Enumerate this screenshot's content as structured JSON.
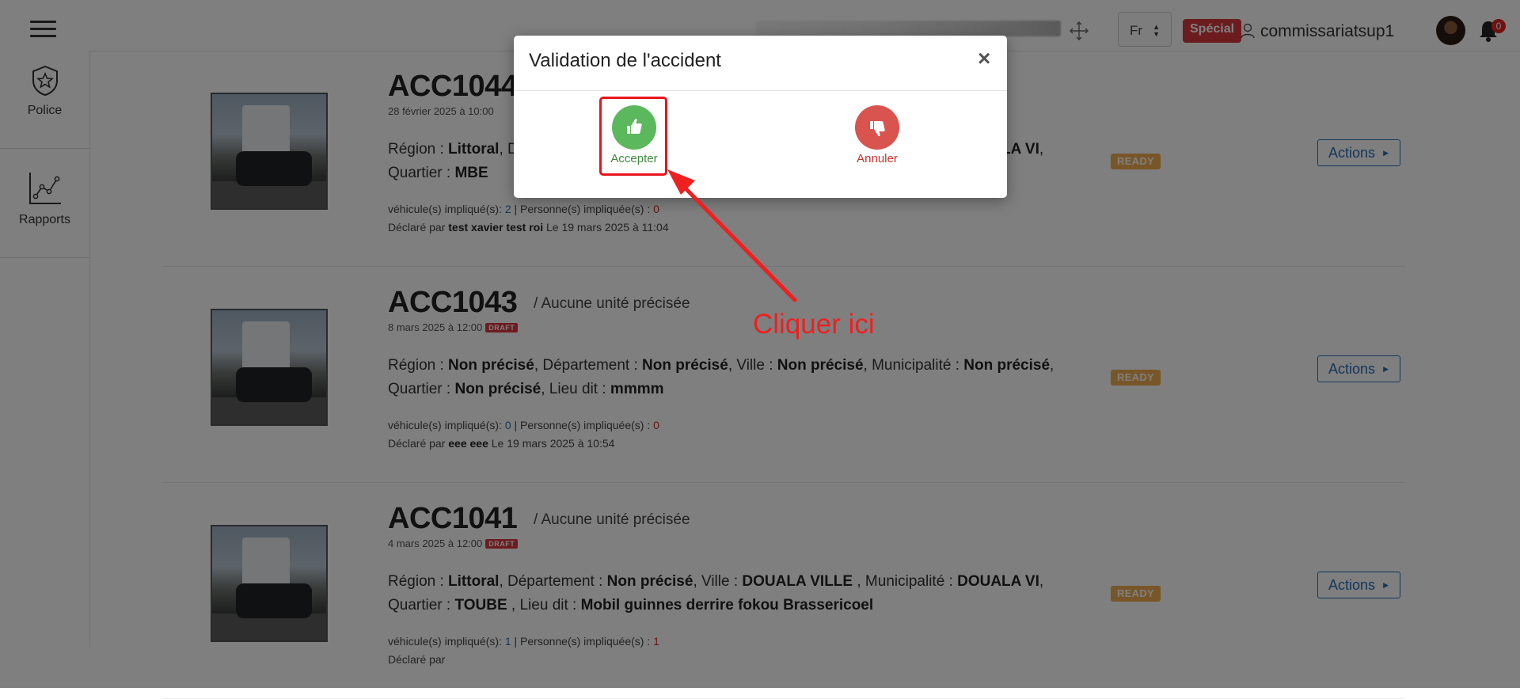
{
  "header": {
    "language": "Fr",
    "badge": "Spécial",
    "username": "commissariatsup1",
    "notification_count": "0"
  },
  "sidebar": {
    "items": [
      {
        "label": "Police",
        "icon": "police-badge-icon"
      },
      {
        "label": "Rapports",
        "icon": "line-chart-icon"
      }
    ]
  },
  "accidents": [
    {
      "id": "ACC1044",
      "unit": "",
      "date": "28 février 2025 à 10:00",
      "draft": "",
      "location_html": "Région : <b>Littoral</b>, Département : <b>Non précisé</b>, Ville : <b>DOUALA VILLE</b> , Municipalité : <b>DOUALA VI</b>, Quartier : <b>MBE</b>",
      "vehicles_label": "véhicule(s) impliqué(s):",
      "vehicles": "2",
      "persons_label": "| Personne(s) impliquée(s) :",
      "persons": "0",
      "declared_prefix": "Déclaré par",
      "declared_by": "test xavier test roi",
      "declared_on": "Le 19 mars 2025 à 11:04",
      "status": "READY",
      "actions_label": "Actions"
    },
    {
      "id": "ACC1043",
      "unit": "/ Aucune unité précisée",
      "date": "8 mars 2025 à 12:00",
      "draft": "DRAFT",
      "location_html": "Région : <b>Non précisé</b>, Département : <b>Non précisé</b>, Ville : <b>Non précisé</b>, Municipalité : <b>Non précisé</b>, Quartier : <b>Non précisé</b>, Lieu dit : <b>mmmm</b>",
      "vehicles_label": "véhicule(s) impliqué(s):",
      "vehicles": "0",
      "persons_label": "| Personne(s) impliquée(s) :",
      "persons": "0",
      "declared_prefix": "Déclaré par",
      "declared_by": "eee eee",
      "declared_on": "Le 19 mars 2025 à 10:54",
      "status": "READY",
      "actions_label": "Actions"
    },
    {
      "id": "ACC1041",
      "unit": "/ Aucune unité précisée",
      "date": "4 mars 2025 à 12:00",
      "draft": "DRAFT",
      "location_html": "Région : <b>Littoral</b>, Département : <b>Non précisé</b>, Ville : <b>DOUALA VILLE</b> , Municipalité : <b>DOUALA VI</b>, Quartier : <b>TOUBE</b> , Lieu dit : <b>Mobil guinnes derrire fokou Brassericoel</b>",
      "vehicles_label": "véhicule(s) impliqué(s):",
      "vehicles": "1",
      "persons_label": "| Personne(s) impliquée(s) :",
      "persons": "1",
      "declared_prefix": "Déclaré par",
      "declared_by": "",
      "declared_on": "",
      "status": "READY",
      "actions_label": "Actions"
    }
  ],
  "modal": {
    "title": "Validation de l'accident",
    "close": "×",
    "accept_label": "Accepter",
    "cancel_label": "Annuler"
  },
  "annotation": {
    "text": "Cliquer ici",
    "color": "#ee2020"
  },
  "colors": {
    "accept": "#5cb85c",
    "cancel": "#d9534f",
    "ready": "#f0ad4e",
    "draft": "#d9383f",
    "actions_border": "#2a6db8"
  }
}
